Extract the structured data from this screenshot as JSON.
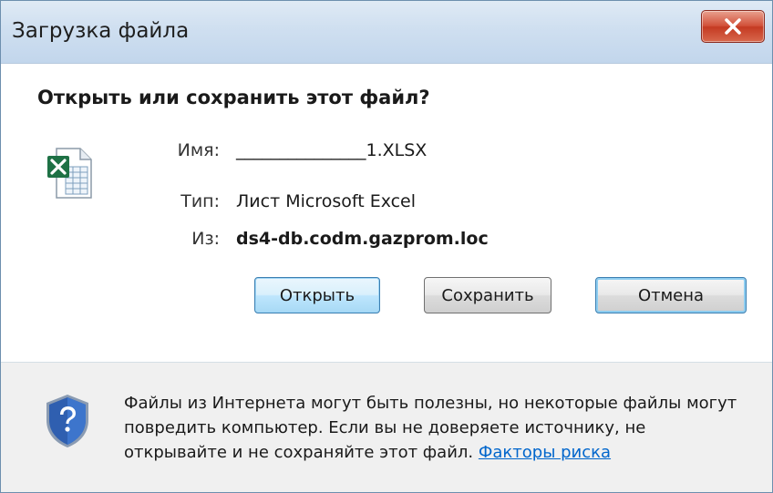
{
  "window": {
    "title": "Загрузка файла",
    "close_label": "×"
  },
  "dialog": {
    "question": "Открыть или сохранить этот файл?",
    "file_icon": "excel-file-icon",
    "name_label": "Имя:",
    "name_value": "_______________1.XLSX",
    "type_label": "Тип:",
    "type_value": "Лист Microsoft Excel",
    "from_label": "Из:",
    "from_value": "ds4-db.codm.gazprom.loc"
  },
  "buttons": {
    "open": "Открыть",
    "save": "Сохранить",
    "cancel": "Отмена"
  },
  "footer": {
    "shield_icon": "security-shield-question-icon",
    "warning_text": "Файлы из Интернета могут быть полезны, но некоторые файлы могут повредить компьютер. Если вы не доверяете источнику, не открывайте и не сохраняйте этот файл.",
    "link_text": "Факторы риска"
  },
  "colors": {
    "title_bar": "#cfdff0",
    "close_button": "#c43a22",
    "default_button": "#bee6fd",
    "link": "#0066cc",
    "excel_green": "#1e7145",
    "shield_blue": "#2f5fb0"
  }
}
